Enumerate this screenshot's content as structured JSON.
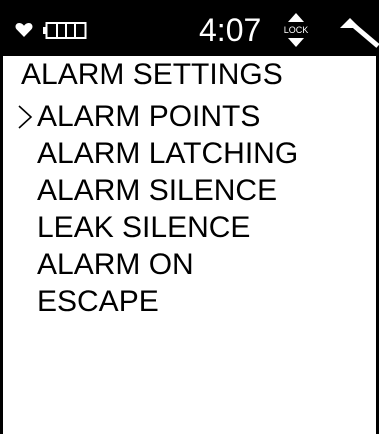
{
  "status_bar": {
    "time": "4:07",
    "lock_label": "LOCK",
    "icons": [
      "heart-icon",
      "battery-icon",
      "lock-arrows-icon",
      "signal-icon"
    ],
    "battery_level": 0.0
  },
  "menu": {
    "title": "ALARM SETTINGS",
    "selected_index": 0,
    "items": [
      {
        "label": "ALARM POINTS"
      },
      {
        "label": "ALARM LATCHING"
      },
      {
        "label": "ALARM SILENCE"
      },
      {
        "label": "LEAK SILENCE"
      },
      {
        "label": "ALARM ON"
      },
      {
        "label": "ESCAPE"
      }
    ]
  },
  "colors": {
    "foreground": "#000000",
    "background": "#ffffff",
    "status_text": "#ffffff"
  }
}
